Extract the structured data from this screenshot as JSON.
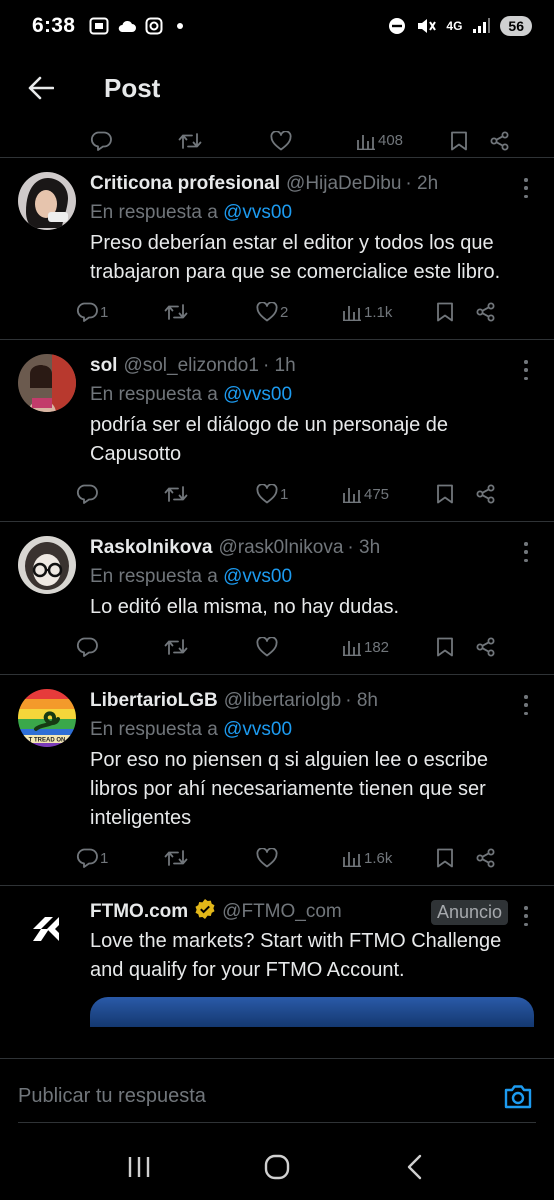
{
  "status": {
    "time": "6:38",
    "network": "4G",
    "battery": "56"
  },
  "header": {
    "title": "Post"
  },
  "top_actions": {
    "views": "408"
  },
  "tweets": [
    {
      "name": "Criticona profesional",
      "handle": "@HijaDeDibu",
      "time": "· 2h",
      "in_reply_prefix": "En respuesta a",
      "in_reply_to": "@vvs00",
      "text": "Preso deberían estar el editor y todos los que trabajaron para que se comercialice este libro.",
      "replies": "1",
      "likes": "2",
      "views": "1.1k"
    },
    {
      "name": "sol",
      "handle": "@sol_elizondo1",
      "time": "· 1h",
      "in_reply_prefix": "En respuesta a",
      "in_reply_to": "@vvs00",
      "text": "podría ser el diálogo de un personaje de Capusotto",
      "replies": "",
      "likes": "1",
      "views": "475"
    },
    {
      "name": "Raskolnikova",
      "handle": "@rask0lnikova",
      "time": "· 3h",
      "in_reply_prefix": "En respuesta a",
      "in_reply_to": "@vvs00",
      "text": "Lo editó ella misma, no hay dudas.",
      "replies": "",
      "likes": "",
      "views": "182"
    },
    {
      "name": "LibertarioLGB",
      "handle": "@libertariolgb",
      "time": "· 8h",
      "in_reply_prefix": "En respuesta a",
      "in_reply_to": "@vvs00",
      "text": "Por eso no piensen q si alguien lee o escribe libros por ahí necesariamente tienen que ser inteligentes",
      "replies": "1",
      "likes": "",
      "views": "1.6k",
      "avatar_text": "T TREAD ON"
    }
  ],
  "ad": {
    "name": "FTMO.com",
    "handle": "@FTMO_com",
    "badge": "Anuncio",
    "text": "Love the markets? Start with FTMO Challenge and qualify for your FTMO Account."
  },
  "reply_bar": {
    "placeholder": "Publicar tu respuesta"
  },
  "colors": {
    "background": "#000000",
    "text": "#e7e9ea",
    "muted": "#71767b",
    "accent": "#1d9bf0",
    "border": "#2f3336"
  }
}
